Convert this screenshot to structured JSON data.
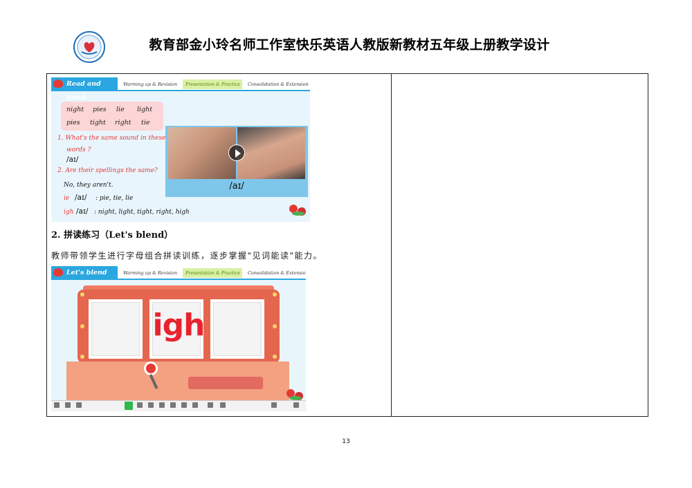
{
  "header": {
    "title": "教育部金小玲名师工作室快乐英语人教版新教材五年级上册教学设计",
    "logo_icon": "heart-seal-icon",
    "logo_color": "#1f6fb5"
  },
  "slide1": {
    "label": "Read and finish",
    "steps": [
      "Warming up & Revision",
      "Presentation & Practice",
      "Consolidation & Extension"
    ],
    "words_row1": [
      "night",
      "pies",
      "lie",
      "light"
    ],
    "words_row2": [
      "pies",
      "tight",
      "right",
      "tie"
    ],
    "question1_line1": "1. What's the same sound in these",
    "question1_line2": "words ?",
    "answer1": "/aɪ/",
    "question2": "2. Are their spellings the same?",
    "answer2": "No, they aren't.",
    "ie_letters": "ie",
    "ie_ipa": "/aɪ/",
    "ie_words": ": pie, tie, lie",
    "igh_letters": "igh",
    "igh_ipa": "/aɪ/",
    "igh_words": ": night, light, tight, right, high",
    "video_ipa": "/aɪ/",
    "play_icon": "play-icon"
  },
  "section2": {
    "title": "2. 拼读练习（Let's blend）",
    "paragraph": "教师带领学生进行字母组合拼读训练，逐步掌握\"见词能读\"能力。"
  },
  "slide2": {
    "label": "Let's blend",
    "steps": [
      "Warming up & Revision",
      "Presentation & Practice",
      "Consolidation & Extension"
    ],
    "center_letters": "igh"
  },
  "colors": {
    "accent_blue": "#2aa7e0",
    "highlight_red": "#e53935",
    "active_step": "#d9f0a6"
  },
  "footer": {
    "page_number": "13"
  }
}
